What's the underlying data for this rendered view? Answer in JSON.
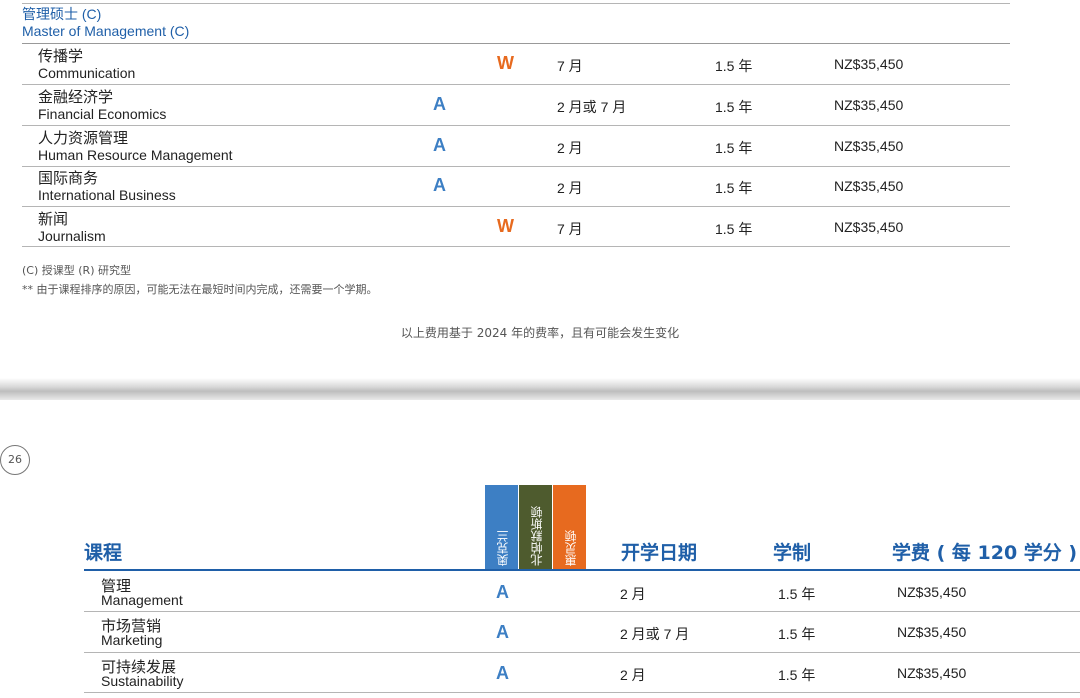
{
  "top_section": {
    "title_zh": "管理硕士 (C)",
    "title_en": "Master of Management (C)",
    "rows": [
      {
        "zh": "传播学",
        "en": "Communication",
        "mark": "W",
        "start": "7 月",
        "duration": "1.5 年",
        "fee": "NZ$35,450"
      },
      {
        "zh": "金融经济学",
        "en": "Financial Economics",
        "mark": "A",
        "start": "2 月或 7 月",
        "duration": "1.5 年",
        "fee": "NZ$35,450"
      },
      {
        "zh": "人力资源管理",
        "en": "Human Resource Management",
        "mark": "A",
        "start": "2 月",
        "duration": "1.5 年",
        "fee": "NZ$35,450"
      },
      {
        "zh": "国际商务",
        "en": "International Business",
        "mark": "A",
        "start": "2 月",
        "duration": "1.5 年",
        "fee": "NZ$35,450"
      },
      {
        "zh": "新闻",
        "en": "Journalism",
        "mark": "W",
        "start": "7 月",
        "duration": "1.5 年",
        "fee": "NZ$35,450"
      }
    ],
    "notes": [
      "(C) 授课型 (R) 研究型",
      "** 由于课程排序的原因，可能无法在最短时间内完成，还需要一个学期。"
    ],
    "fee_note": "以上费用基于 2024 年的费率，且有可能会发生变化"
  },
  "page2": {
    "page_number": "26",
    "headers": {
      "course": "课程",
      "start": "开学日期",
      "duration": "学制",
      "fee": "学费 ( 每 120 学分 )"
    },
    "campus_tabs": [
      {
        "label": "奥克兰",
        "color": "#3d7fc4"
      },
      {
        "label": "北帕默斯顿",
        "color": "#4e5b2e"
      },
      {
        "label": "惠灵顿",
        "color": "#e76a1f"
      }
    ],
    "rows": [
      {
        "zh": "管理",
        "en": "Management",
        "mark": "A",
        "start": "2 月",
        "duration": "1.5 年",
        "fee": "NZ$35,450"
      },
      {
        "zh": "市场营销",
        "en": "Marketing",
        "mark": "A",
        "start": "2 月或 7 月",
        "duration": "1.5 年",
        "fee": "NZ$35,450"
      },
      {
        "zh": "可持续发展",
        "en": "Sustainability",
        "mark": "A",
        "start": "2 月",
        "duration": "1.5 年",
        "fee": "NZ$35,450"
      }
    ]
  },
  "colors": {
    "accent_blue": "#1f5fa8",
    "auckland_blue": "#3d7fc4",
    "wellington_orange": "#e76a1f",
    "palmerston_green": "#4e5b2e"
  }
}
